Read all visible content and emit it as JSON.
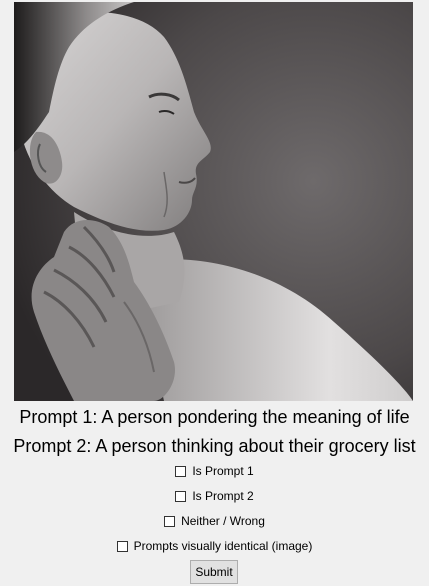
{
  "image": {
    "subject": "black and white portrait"
  },
  "prompts": {
    "prompt1": "Prompt 1: A person pondering the meaning of life",
    "prompt2": "Prompt 2: A person thinking about their grocery list"
  },
  "options": [
    {
      "label": "Is Prompt 1",
      "checked": false
    },
    {
      "label": "Is Prompt 2",
      "checked": false
    },
    {
      "label": "Neither / Wrong",
      "checked": false
    },
    {
      "label": "Prompts visually identical (image)",
      "checked": false
    }
  ],
  "submit_label": "Submit",
  "colors": {
    "background": "#f0f0f0",
    "button": "#e1e1e1"
  }
}
